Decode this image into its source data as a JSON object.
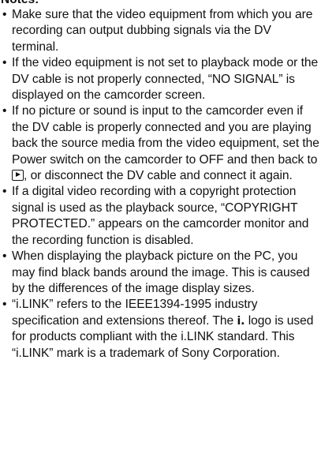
{
  "heading": "Notes:",
  "bullet_char": "•",
  "notes": [
    {
      "text": "Make sure that the video equipment from which you are recording can output dubbing signals via the DV terminal."
    },
    {
      "text": "If the video equipment is not set to playback mode or the DV cable is not properly connected, “NO SIGNAL” is displayed on the camcorder screen."
    },
    {
      "text_before_icon": "If no picture or sound is input to the camcorder even if the DV cable is properly connected and you are playing back the source media from the video equipment, set the Power switch on the camcorder to OFF and then back to",
      "icon": "play-icon",
      "text_after_icon": ", or disconnect the DV cable and connect it again."
    },
    {
      "text": "If a digital video recording with a copyright protection signal is used as the playback source, “COPYRIGHT PROTECTED.” appears on the camcorder monitor and the recording function is disabled."
    },
    {
      "text": "When displaying the playback picture on the PC, you may find black bands around the image. This is caused by the differences of the image display sizes."
    },
    {
      "text_before_icon": "“i.LINK” refers to the IEEE1394-1995 industry specification and extensions thereof. The",
      "icon": "i-link-logo-icon",
      "icon_glyph": "i.",
      "text_after_icon": "logo is used for products compliant with the i.LINK standard. This “i.LINK” mark is a trademark of Sony Corporation."
    }
  ]
}
